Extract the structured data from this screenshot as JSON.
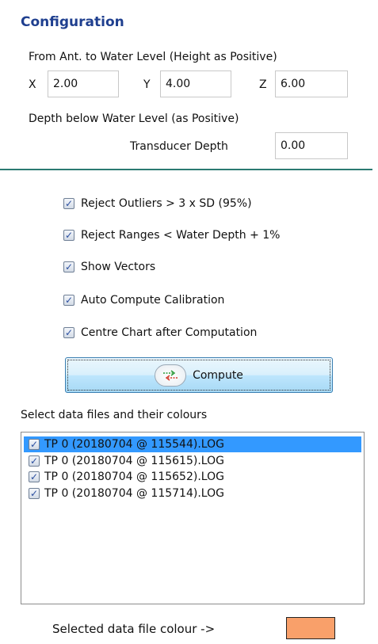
{
  "config": {
    "title": "Configuration",
    "from_ant_label": "From Ant. to Water Level (Height as Positive)",
    "x_label": "X",
    "x_value": "2.00",
    "y_label": "Y",
    "y_value": "4.00",
    "z_label": "Z",
    "z_value": "6.00",
    "depth_label": "Depth below Water Level (as Positive)",
    "transducer_label": "Transducer Depth",
    "transducer_value": "0.00"
  },
  "options": [
    {
      "label": "Reject Outliers > 3 x SD (95%)",
      "checked": true
    },
    {
      "label": "Reject Ranges < Water Depth + 1%",
      "checked": true
    },
    {
      "label": "Show Vectors",
      "checked": true
    },
    {
      "label": "Auto Compute Calibration",
      "checked": true
    },
    {
      "label": "Centre Chart after Computation",
      "checked": true
    }
  ],
  "compute": {
    "label": "Compute",
    "icon": "compute-arrows-icon"
  },
  "files": {
    "heading": "Select data files and their  colours",
    "items": [
      {
        "label": "TP 0 (20180704 @ 115544).LOG",
        "checked": true,
        "selected": true
      },
      {
        "label": "TP 0 (20180704 @ 115615).LOG",
        "checked": true,
        "selected": false
      },
      {
        "label": "TP 0 (20180704 @ 115652).LOG",
        "checked": true,
        "selected": false
      },
      {
        "label": "TP 0 (20180704 @ 115714).LOG",
        "checked": true,
        "selected": false
      }
    ]
  },
  "selected_colour": {
    "label": "Selected data file colour ->",
    "color": "#f9a06a"
  },
  "check_glyph": "✓"
}
